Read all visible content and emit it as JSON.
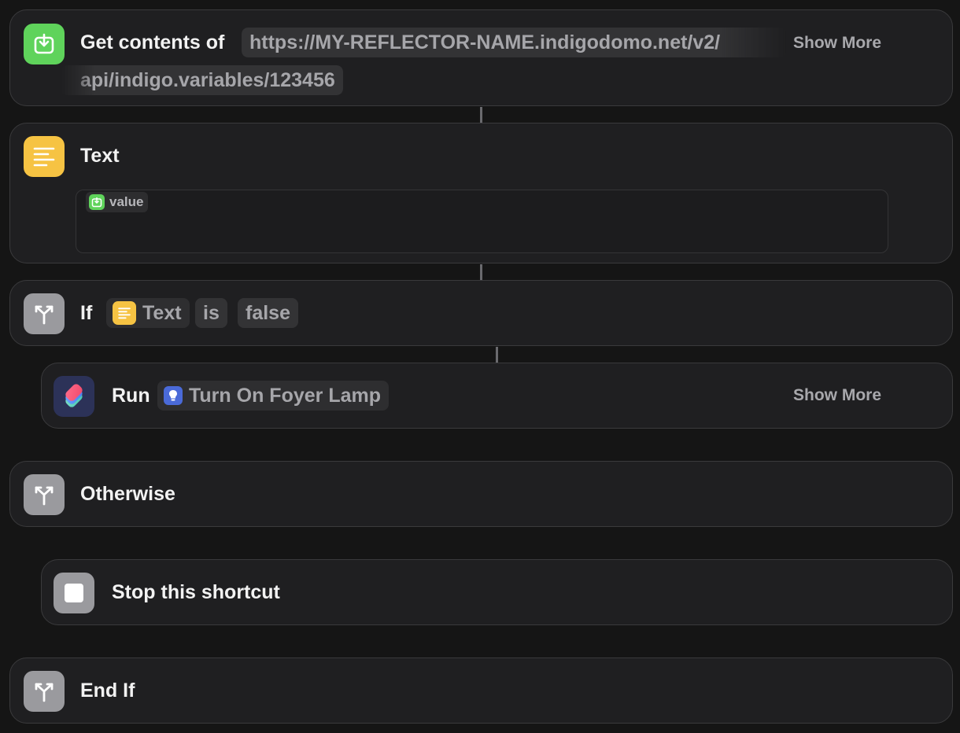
{
  "actions": {
    "get_contents": {
      "title": "Get contents of",
      "url_line1": "https://MY-REFLECTOR-NAME.indigodomo.net/v2/",
      "url_line2": "api/indigo.variables/123456",
      "show_more": "Show More",
      "icon": "download-icon",
      "color": "#5fd35b"
    },
    "text": {
      "title": "Text",
      "token_label": "value",
      "icon": "text-lines-icon",
      "color": "#f6c343"
    },
    "if": {
      "title": "If",
      "operand": "Text",
      "operator": "is",
      "value": "false",
      "icon": "branch-icon"
    },
    "run": {
      "title": "Run",
      "shortcut": "Turn On Foyer Lamp",
      "show_more": "Show More",
      "icon": "shortcuts-icon",
      "shortcut_icon": "lightbulb-icon"
    },
    "otherwise": {
      "title": "Otherwise",
      "icon": "branch-icon"
    },
    "stop": {
      "title": "Stop this shortcut",
      "icon": "stop-icon"
    },
    "end_if": {
      "title": "End If",
      "icon": "branch-icon"
    }
  }
}
